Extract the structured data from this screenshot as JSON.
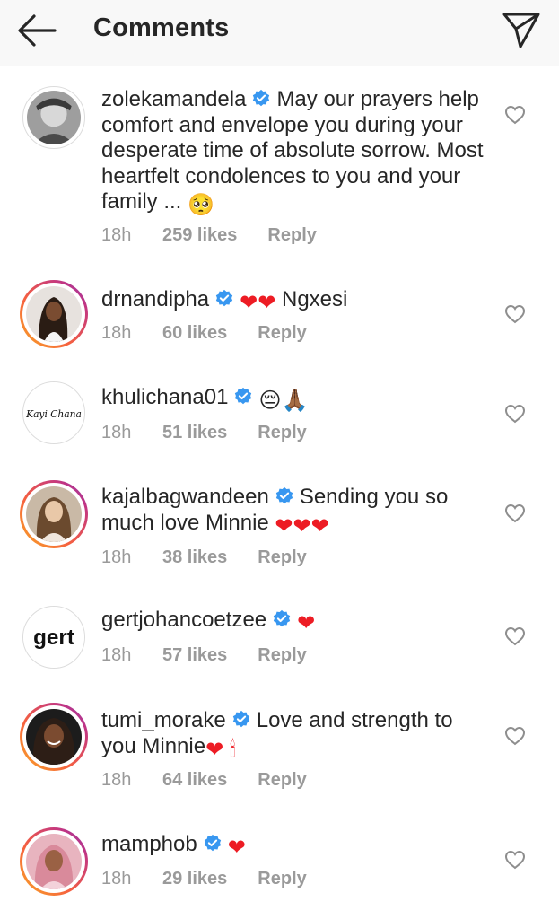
{
  "header": {
    "title": "Comments"
  },
  "comments": [
    {
      "username": "zolekamandela",
      "text": "May our prayers help comfort and envelope you during your desperate time of absolute sorrow. Most heartfelt condolences to you and your family ...",
      "emojis": "🥺",
      "time": "18h",
      "likes": "259 likes",
      "reply": "Reply"
    },
    {
      "username": "drnandipha",
      "emojis": "❤❤",
      "text": "Ngxesi",
      "time": "18h",
      "likes": "60 likes",
      "reply": "Reply"
    },
    {
      "username": "khulichana01",
      "emojis": "😔🙏🏾",
      "avatar_text": "Kayi Chana",
      "time": "18h",
      "likes": "51 likes",
      "reply": "Reply"
    },
    {
      "username": "kajalbagwandeen",
      "text": "Sending you so much love Minnie",
      "emojis": "❤❤❤",
      "time": "18h",
      "likes": "38 likes",
      "reply": "Reply"
    },
    {
      "username": "gertjohancoetzee",
      "emojis": "❤",
      "avatar_text": "gert",
      "time": "18h",
      "likes": "57 likes",
      "reply": "Reply"
    },
    {
      "username": "tumi_morake",
      "text": "Love and strength to you Minnie",
      "emojis": "❤ 🕯",
      "time": "18h",
      "likes": "64 likes",
      "reply": "Reply"
    },
    {
      "username": "mamphob",
      "emojis": "❤",
      "time": "18h",
      "likes": "29 likes",
      "reply": "Reply"
    }
  ],
  "icons": {
    "back": "arrow-left-icon",
    "send": "paper-plane-icon",
    "verified": "verified-badge-icon",
    "like": "heart-outline-icon"
  },
  "colors": {
    "verified": "#3897f0",
    "heart": "#ed1c24",
    "meta": "#9a9a9a",
    "header_bg": "#f8f8f8"
  }
}
